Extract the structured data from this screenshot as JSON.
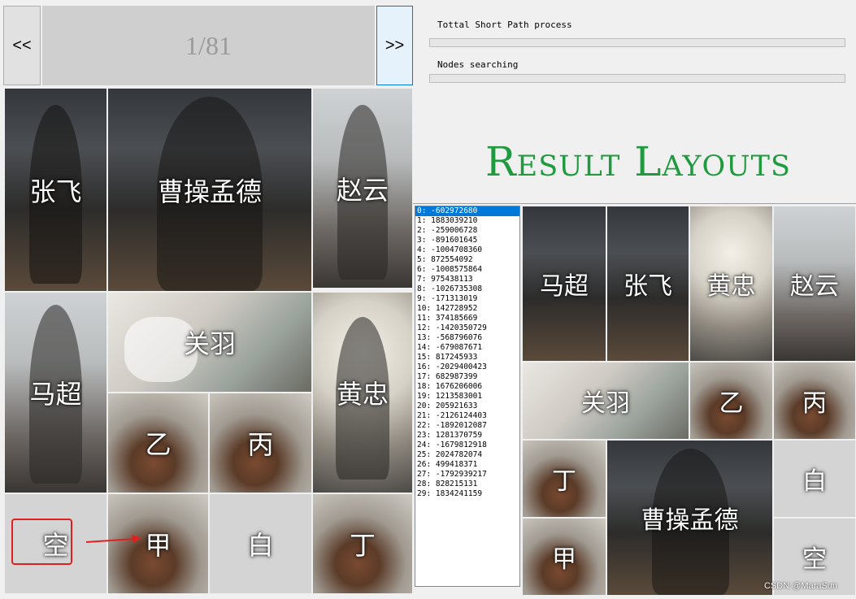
{
  "nav": {
    "prev_label": "<<",
    "next_label": ">>",
    "page_counter": "1/81"
  },
  "progress": {
    "total_label": "Tottal Short Path process",
    "total_value": 0,
    "nodes_label": "Nodes searching",
    "nodes_value": 0
  },
  "title": "Result Layouts",
  "puzzle_tiles": [
    {
      "name": "张飞"
    },
    {
      "name": "曹操孟德"
    },
    {
      "name": "赵云"
    },
    {
      "name": "马超"
    },
    {
      "name": "关羽"
    },
    {
      "name": "黄忠"
    },
    {
      "name": "乙"
    },
    {
      "name": "丙"
    },
    {
      "name": "空"
    },
    {
      "name": "甲"
    },
    {
      "name": "白"
    },
    {
      "name": "丁"
    }
  ],
  "result_tiles": [
    {
      "name": "马超"
    },
    {
      "name": "张飞"
    },
    {
      "name": "黄忠"
    },
    {
      "name": "赵云"
    },
    {
      "name": "关羽"
    },
    {
      "name": "乙"
    },
    {
      "name": "丙"
    },
    {
      "name": "丁"
    },
    {
      "name": "曹操孟德"
    },
    {
      "name": "白"
    },
    {
      "name": "甲"
    },
    {
      "name": "空"
    }
  ],
  "result_list": [
    "0: -602972680",
    "1: 1883039210",
    "2: -259006728",
    "3: -891601645",
    "4: -1004708360",
    "5: 872554092",
    "6: -1008575864",
    "7: 975438113",
    "8: -1026735308",
    "9: -171313019",
    "10: 142728952",
    "11: 374185669",
    "12: -1420350729",
    "13: -568796076",
    "14: -679087671",
    "15: 817245933",
    "16: -2029400423",
    "17: 682987399",
    "18: 1676206006",
    "19: 1213583001",
    "20: 205921633",
    "21: -2126124403",
    "22: -1892012087",
    "23: 1281370759",
    "24: -1679812918",
    "25: 2024782074",
    "26: 499418371",
    "27: -1792939217",
    "28: 828215131",
    "29: 1834241159"
  ],
  "watermark": "CSDN @MaraSun",
  "colors": {
    "title": "#1f9a3f",
    "selection": "#0078d7",
    "highlight_box": "#e02020"
  }
}
